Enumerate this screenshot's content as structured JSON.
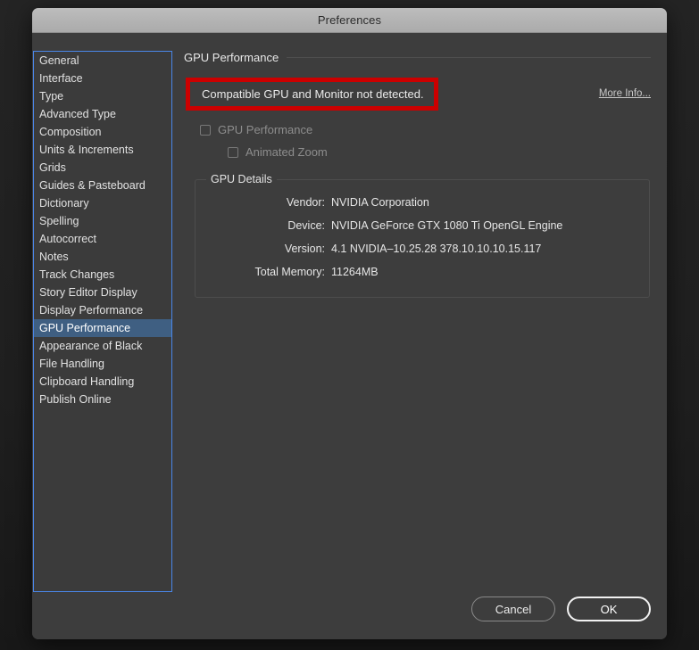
{
  "window": {
    "title": "Preferences"
  },
  "sidebar": {
    "items": [
      {
        "label": "General",
        "selected": false
      },
      {
        "label": "Interface",
        "selected": false
      },
      {
        "label": "Type",
        "selected": false
      },
      {
        "label": "Advanced Type",
        "selected": false
      },
      {
        "label": "Composition",
        "selected": false
      },
      {
        "label": "Units & Increments",
        "selected": false
      },
      {
        "label": "Grids",
        "selected": false
      },
      {
        "label": "Guides & Pasteboard",
        "selected": false
      },
      {
        "label": "Dictionary",
        "selected": false
      },
      {
        "label": "Spelling",
        "selected": false
      },
      {
        "label": "Autocorrect",
        "selected": false
      },
      {
        "label": "Notes",
        "selected": false
      },
      {
        "label": "Track Changes",
        "selected": false
      },
      {
        "label": "Story Editor Display",
        "selected": false
      },
      {
        "label": "Display Performance",
        "selected": false
      },
      {
        "label": "GPU Performance",
        "selected": true
      },
      {
        "label": "Appearance of Black",
        "selected": false
      },
      {
        "label": "File Handling",
        "selected": false
      },
      {
        "label": "Clipboard Handling",
        "selected": false
      },
      {
        "label": "Publish Online",
        "selected": false
      }
    ]
  },
  "main": {
    "section_title": "GPU Performance",
    "warning": {
      "message": "Compatible GPU and Monitor not detected.",
      "highlight_color": "#cc0000"
    },
    "more_info_link": "More Info...",
    "checkboxes": [
      {
        "label": "GPU Performance",
        "checked": false,
        "enabled": false
      },
      {
        "label": "Animated Zoom",
        "checked": false,
        "enabled": false
      }
    ],
    "details": {
      "legend": "GPU Details",
      "rows": [
        {
          "key": "Vendor:",
          "value": "NVIDIA Corporation"
        },
        {
          "key": "Device:",
          "value": "NVIDIA GeForce GTX 1080 Ti OpenGL Engine"
        },
        {
          "key": "Version:",
          "value": "4.1 NVIDIA–10.25.28 378.10.10.10.15.117"
        },
        {
          "key": "Total Memory:",
          "value": "11264MB"
        }
      ]
    }
  },
  "footer": {
    "cancel_label": "Cancel",
    "ok_label": "OK"
  },
  "colors": {
    "dialog_bg": "#3d3d3d",
    "titlebar": "#b3b3b3",
    "focus_border": "#4a86e8",
    "selection": "#3f5f82",
    "warning_red": "#cc0000"
  }
}
